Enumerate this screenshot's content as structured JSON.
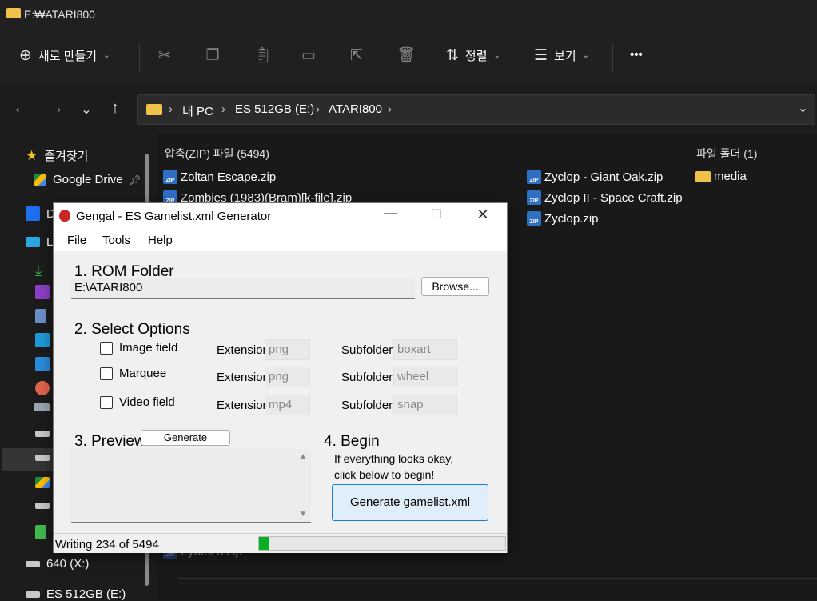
{
  "explorer": {
    "title": "E:₩ATARI800",
    "toolbar": {
      "new_label": "새로 만들기",
      "sort_label": "정렬",
      "view_label": "보기",
      "more_label": "•••"
    },
    "breadcrumb": [
      "내 PC",
      "ES 512GB (E:)",
      "ATARI800"
    ],
    "sidebar": {
      "favorites": "즐겨찾기",
      "google_drive": "Google Drive",
      "dropbox_partial": "D",
      "pc_partial": "L",
      "drive_640": "640 (X:)",
      "drive_es": "ES 512GB (E:)"
    },
    "groups": {
      "zip_header": "압축(ZIP) 파일 (5494)",
      "folder_header": "파일 폴더 (1)"
    },
    "files_col1": [
      "Zoltan Escape.zip",
      "Zombies (1983)(Bram)[k-file].zip"
    ],
    "file_hidden": "Zybex 3.zip",
    "files_col2": [
      "Zyclop - Giant Oak.zip",
      "Zyclop II - Space Craft.zip",
      "Zyclop.zip"
    ],
    "folders": [
      "media"
    ],
    "zip_badge": "ZIP"
  },
  "gengal": {
    "title": "Gengal - ES Gamelist.xml Generator",
    "menu": [
      "File",
      "Tools",
      "Help"
    ],
    "rom_folder": {
      "heading": "1. ROM Folder",
      "path": "E:\\ATARI800",
      "browse_label": "Browse..."
    },
    "options": {
      "heading": "2. Select Options",
      "rows": [
        {
          "label": "Image field",
          "ext_label": "Extension",
          "ext_value": "png",
          "sub_label": "Subfolder",
          "sub_value": "boxart"
        },
        {
          "label": "Marquee",
          "ext_label": "Extension",
          "ext_value": "png",
          "sub_label": "Subfolder",
          "sub_value": "wheel"
        },
        {
          "label": "Video field",
          "ext_label": "Extension",
          "ext_value": "mp4",
          "sub_label": "Subfolder",
          "sub_value": "snap"
        }
      ]
    },
    "preview": {
      "heading": "3. Preview",
      "generate_label": "Generate"
    },
    "begin": {
      "heading": "4. Begin",
      "line1": "If everything looks okay,",
      "line2": "click below to begin!",
      "button_label": "Generate gamelist.xml"
    },
    "status": {
      "text": "Writing 234 of 5494",
      "progress": 0.043
    }
  },
  "colors": {
    "explorer_bg": "#1c1c1c",
    "folder": "#f0c24a",
    "zip_icon": "#2f6fc4",
    "accent": "#1e7fd1",
    "progress": "#06b025"
  }
}
